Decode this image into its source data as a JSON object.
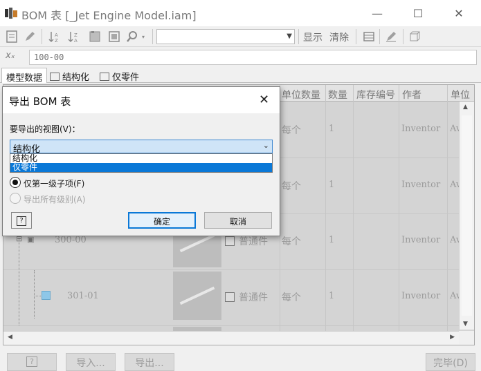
{
  "window": {
    "title": "BOM 表 [_Jet Engine Model.iam]",
    "min_label": "—",
    "max_label": "☐",
    "close_label": "✕"
  },
  "toolbar": {
    "icons": [
      "bom-icon",
      "edit-icon",
      "sort-ascending-icon",
      "sort-descending-icon",
      "columns-icon",
      "export-icon",
      "search-icon",
      "dropdown-arrow-icon"
    ],
    "filter_value": "",
    "show_label": "显示",
    "clear_label": "清除",
    "extra_icons": [
      "table-icon",
      "edit-icon",
      "cube-icon"
    ]
  },
  "partbar": {
    "fx_label": "xₓ",
    "part_number": "100-00"
  },
  "tabs": [
    {
      "label": "模型数据"
    },
    {
      "label": "结构化"
    },
    {
      "label": "仅零件"
    }
  ],
  "table": {
    "headers": [
      "单位数量",
      "数量",
      "库存编号",
      "作者",
      "单位"
    ],
    "rows": [
      {
        "item": "",
        "unit_qty": "每个",
        "qty": "1",
        "author": "Inventor",
        "unit": "Av",
        "type": ""
      },
      {
        "item": "",
        "unit_qty": "每个",
        "qty": "1",
        "author": "Inventor",
        "unit": "Av",
        "type": ""
      },
      {
        "item": "300-00",
        "unit_qty": "每个",
        "qty": "1",
        "author": "Inventor",
        "unit": "Av",
        "type": "普通件"
      },
      {
        "item": "301-01",
        "unit_qty": "每个",
        "qty": "1",
        "author": "Inventor",
        "unit": "Av",
        "type": "普通件"
      }
    ]
  },
  "bottom_buttons": {
    "help": "?",
    "import": "导入...",
    "export": "导出...",
    "done": "完毕(D)"
  },
  "dialog": {
    "title": "导出 BOM 表",
    "close": "✕",
    "view_label": "要导出的视图(V)：",
    "selected_view": "结构化",
    "options": [
      "结构化",
      "仅零件"
    ],
    "highlighted_option": "仅零件",
    "radio_first_level": "仅第一级子项(F)",
    "radio_all_levels": "导出所有级别(A)",
    "help_label": "?",
    "ok_label": "确定",
    "cancel_label": "取消"
  }
}
